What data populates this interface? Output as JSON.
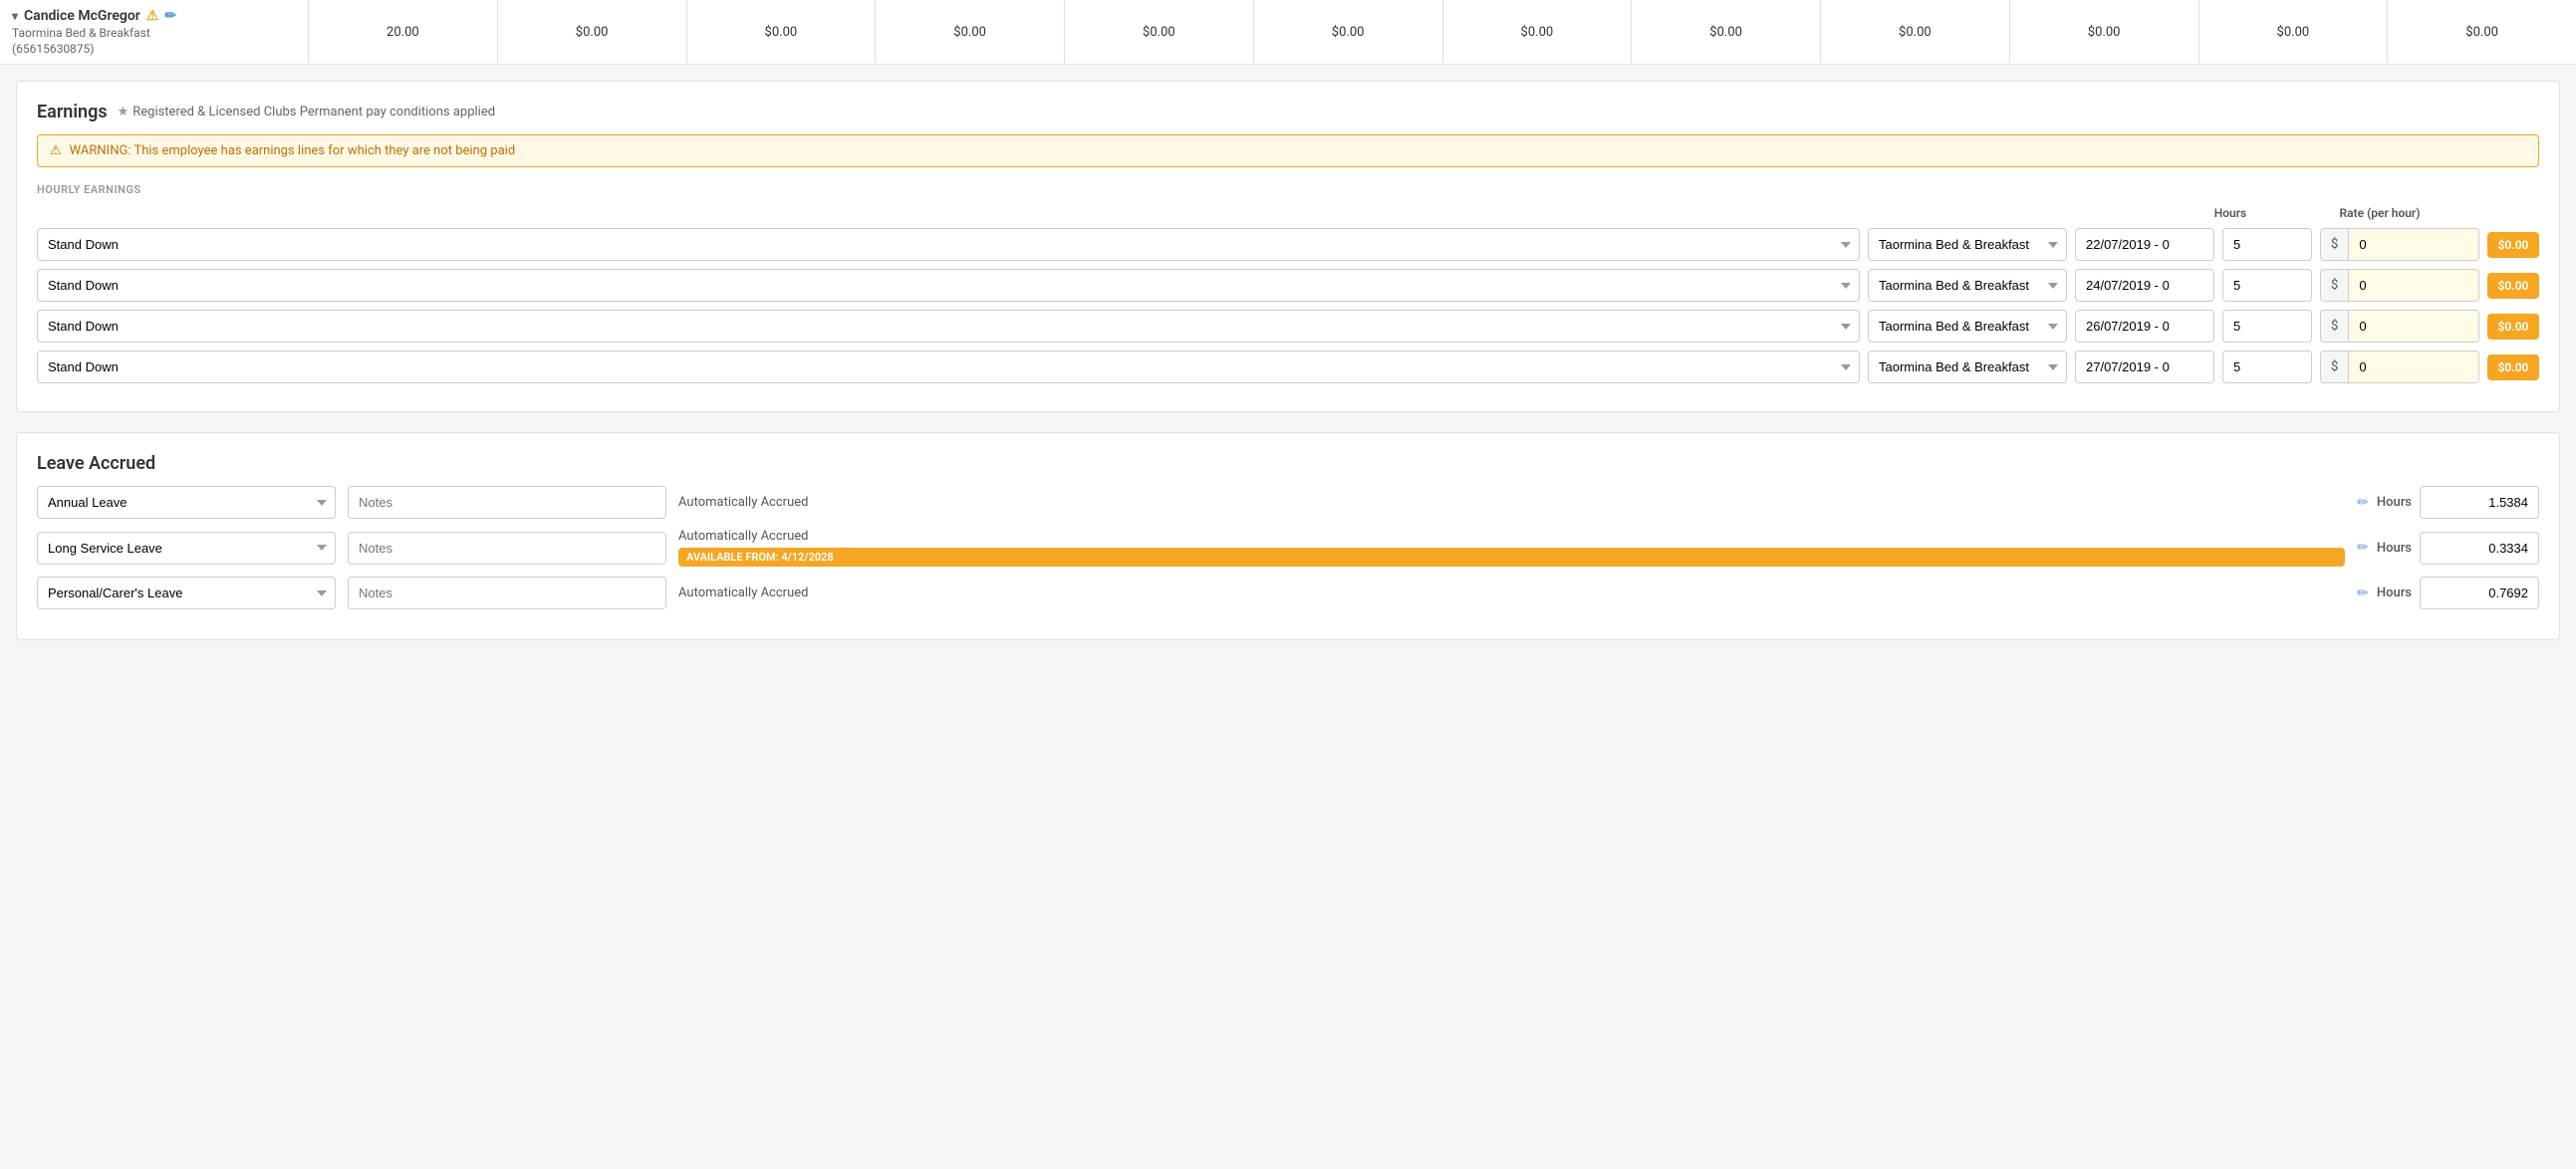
{
  "employee": {
    "name": "Candice McGregor",
    "location": "Taormina Bed & Breakfast",
    "id": "(65615630875)",
    "hours": "20.00",
    "cols": [
      "$0.00",
      "$0.00",
      "$0.00",
      "$0.00",
      "$0.00",
      "$0.00",
      "$0.00",
      "$0.00",
      "$0.00",
      "$0.00",
      "$0.00"
    ]
  },
  "earnings": {
    "title": "Earnings",
    "pay_conditions": "Registered & Licensed Clubs Permanent pay conditions applied",
    "warning": "WARNING: This employee has earnings lines for which they are not being paid",
    "hourly_label": "HOURLY EARNINGS",
    "col_headers": {
      "hours": "Hours",
      "rate": "Rate (per hour)"
    },
    "rows": [
      {
        "type": "Stand Down",
        "location": "Taormina Bed & Breakfast",
        "date": "22/07/2019 - 0",
        "hours": "5",
        "rate_prefix": "$",
        "rate_value": "0",
        "amount": "$0.00"
      },
      {
        "type": "Stand Down",
        "location": "Taormina Bed & Breakfast",
        "date": "24/07/2019 - 0",
        "hours": "5",
        "rate_prefix": "$",
        "rate_value": "0",
        "amount": "$0.00"
      },
      {
        "type": "Stand Down",
        "location": "Taormina Bed & Breakfast",
        "date": "26/07/2019 - 0",
        "hours": "5",
        "rate_prefix": "$",
        "rate_value": "0",
        "amount": "$0.00"
      },
      {
        "type": "Stand Down",
        "location": "Taormina Bed & Breakfast",
        "date": "27/07/2019 - 0",
        "hours": "5",
        "rate_prefix": "$",
        "rate_value": "0",
        "amount": "$0.00"
      }
    ]
  },
  "leave_accrued": {
    "title": "Leave Accrued",
    "rows": [
      {
        "type": "Annual Leave",
        "notes_placeholder": "Notes",
        "accrual": "Automatically Accrued",
        "hours_value": "1.5384",
        "available_from": null
      },
      {
        "type": "Long Service Leave",
        "notes_placeholder": "Notes",
        "accrual": "Automatically Accrued",
        "hours_value": "0.3334",
        "available_from": "AVAILABLE FROM: 4/12/2028"
      },
      {
        "type": "Personal/Carer's Leave",
        "notes_placeholder": "Notes",
        "accrual": "Automatically Accrued",
        "hours_value": "0.7692",
        "available_from": null
      }
    ],
    "hours_label": "Hours"
  }
}
